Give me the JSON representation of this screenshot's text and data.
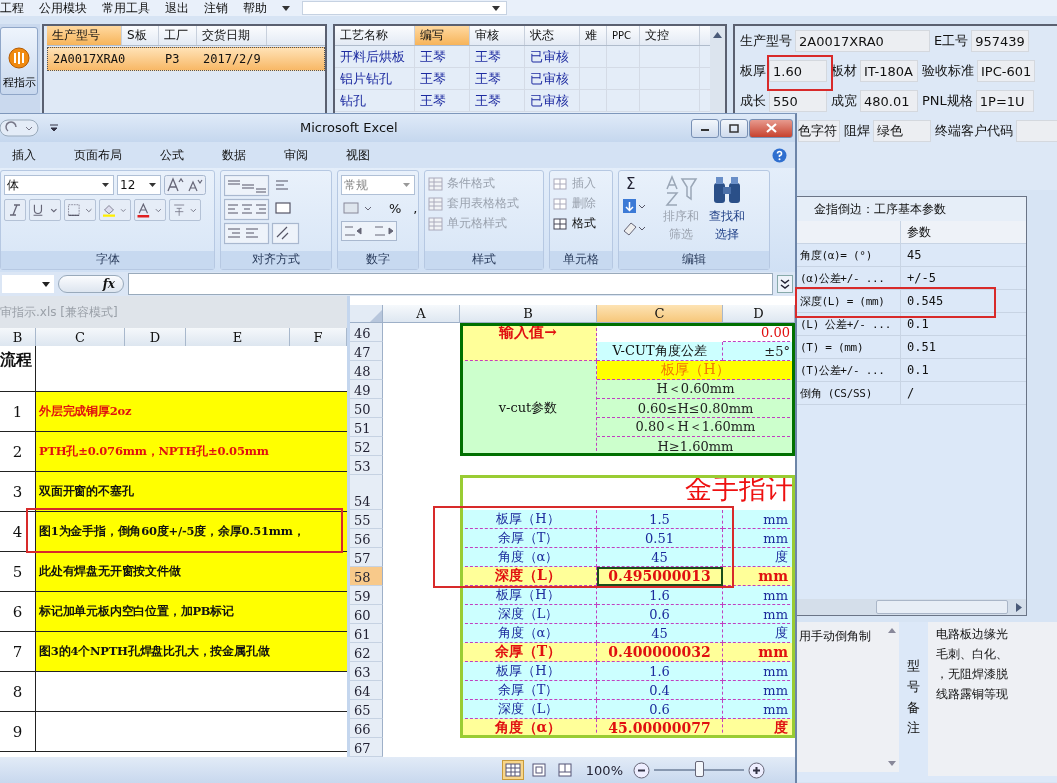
{
  "app": {
    "menu": [
      {
        "label": "工程"
      },
      {
        "label": "公用模块"
      },
      {
        "label": "常用工具"
      },
      {
        "label": "退出"
      },
      {
        "label": "注销"
      },
      {
        "label": "帮助"
      }
    ],
    "side_button": {
      "label": "程指示"
    },
    "order_table": {
      "columns": [
        {
          "label": "生产型号",
          "selected": true
        },
        {
          "label": "S板",
          "selected": false
        },
        {
          "label": "工厂",
          "selected": false
        },
        {
          "label": "交货日期",
          "selected": false
        }
      ],
      "rows": [
        {
          "model": "2A0017XRA0",
          "factory": "P3",
          "date": "2017/2/9",
          "selected": true
        }
      ]
    },
    "process_table": {
      "columns": [
        {
          "label": "工艺名称",
          "selected": false
        },
        {
          "label": "编写",
          "selected": true
        },
        {
          "label": "审核",
          "selected": false
        },
        {
          "label": "状态",
          "selected": false
        },
        {
          "label": "难",
          "selected": false
        },
        {
          "label": "PPC",
          "selected": false
        },
        {
          "label": "文控",
          "selected": false
        }
      ],
      "rows": [
        {
          "name": "开料后烘板",
          "writer": "王琴",
          "reviewer": "王琴",
          "status": "已审核"
        },
        {
          "name": "铝片钻孔",
          "writer": "王琴",
          "reviewer": "王琴",
          "status": "已审核"
        },
        {
          "name": "钻孔",
          "writer": "王琴",
          "reviewer": "王琴",
          "status": "已审核"
        }
      ]
    },
    "info_rows": [
      [
        {
          "label": "生产型号",
          "value": "2A0017XRA0"
        },
        {
          "label": "E工号",
          "value": "957439"
        }
      ],
      [
        {
          "label": "板厚",
          "value": "1.60"
        },
        {
          "label": "板材",
          "value": "IT-180A"
        },
        {
          "label": "验收标准",
          "value": "IPC-601"
        }
      ],
      [
        {
          "label": "成长",
          "value": "550"
        },
        {
          "label": "成宽",
          "value": "480.01"
        },
        {
          "label": "PNL规格",
          "value": "1P=1U"
        }
      ],
      [
        {
          "value": "色字符"
        },
        {
          "label": "阻焊",
          "value": "绿色"
        },
        {
          "label": "终端客户代码"
        }
      ]
    ],
    "param_table": {
      "title": "金指倒边：工序基本参数",
      "column": "参数",
      "rows": [
        {
          "name": "角度(α)=  (°)",
          "value": "45"
        },
        {
          "name": "(α)公差+/- ...",
          "value": "+/-5"
        },
        {
          "name": "深度(L) =  (mm)",
          "value": "0.545"
        },
        {
          "name": "(L) 公差+/- ...",
          "value": "0.1"
        },
        {
          "name": "(T) =  (mm)",
          "value": "0.51"
        },
        {
          "name": "(T)公差+/-  ...",
          "value": "0.1"
        },
        {
          "name": "倒角 (CS/SS)",
          "value": "/"
        }
      ]
    },
    "notes": {
      "left_text": "用手动倒角制",
      "label": "型号备注",
      "right_lines": [
        "电路板边缘光",
        "毛刺、白化、",
        "，无阻焊漆脱",
        "线路露铜等现"
      ]
    }
  },
  "excel": {
    "title": "Microsoft Excel",
    "tabs": [
      {
        "label": "插入"
      },
      {
        "label": "页面布局"
      },
      {
        "label": "公式"
      },
      {
        "label": "数据"
      },
      {
        "label": "审阅"
      },
      {
        "label": "视图"
      }
    ],
    "ribbon": {
      "font_name": "体",
      "font_size": "12",
      "number_format": "常规",
      "percent": "%",
      "comma": ",",
      "sum": "Σ",
      "style_buttons": [
        {
          "label": "条件格式"
        },
        {
          "label": "套用表格格式"
        },
        {
          "label": "单元格样式"
        }
      ],
      "cell_buttons": [
        {
          "label": "插入",
          "disabled": true
        },
        {
          "label": "删除",
          "disabled": true
        },
        {
          "label": "格式",
          "disabled": false
        }
      ],
      "sort_button": {
        "label": "排序和筛选",
        "disabled": true
      },
      "find_button": {
        "label": "查找和选择",
        "disabled": false
      },
      "groups": [
        {
          "label": "字体"
        },
        {
          "label": "对齐方式"
        },
        {
          "label": "数字"
        },
        {
          "label": "样式"
        },
        {
          "label": "单元格"
        },
        {
          "label": "编辑"
        }
      ]
    },
    "formula_bar": {
      "fx": "fx"
    },
    "sheet1": {
      "title": "审指示.xls  [兼容模式]",
      "columns": [
        "B",
        "C",
        "D",
        "E",
        "F"
      ],
      "header": "流程",
      "rows": [
        {
          "number": "1",
          "text": "外层完成铜厚2oz",
          "kind": "red"
        },
        {
          "number": "2",
          "text": "PTH孔±0.076mm，NPTH孔±0.05mm",
          "kind": "red"
        },
        {
          "number": "3",
          "text": "双面开窗的不塞孔",
          "kind": "black"
        },
        {
          "number": "4",
          "text": "图1为金手指，倒角60度+/-5度，余厚0.51mm，",
          "kind": "black"
        },
        {
          "number": "5",
          "text": "此处有焊盘无开窗按文件做",
          "kind": "black"
        },
        {
          "number": "6",
          "text": "标记加单元板内空白位置，加PB标记",
          "kind": "black"
        },
        {
          "number": "7",
          "text": "图3的4个NPTH孔焊盘比孔大，按金属孔做",
          "kind": "black"
        },
        {
          "number": "8",
          "kind": "empty"
        },
        {
          "number": "9",
          "kind": "empty"
        }
      ]
    },
    "sheet2": {
      "columns": [
        {
          "label": "A",
          "selected": false
        },
        {
          "label": "B",
          "selected": false
        },
        {
          "label": "C",
          "selected": true
        },
        {
          "label": "D",
          "selected": false
        }
      ],
      "row_numbers": [
        {
          "label": "46",
          "selected": false
        },
        {
          "label": "47",
          "selected": false
        },
        {
          "label": "48",
          "selected": false
        },
        {
          "label": "49",
          "selected": false
        },
        {
          "label": "50",
          "selected": false
        },
        {
          "label": "51",
          "selected": false
        },
        {
          "label": "52",
          "selected": false
        },
        {
          "label": "53",
          "selected": false
        },
        {
          "label": "54",
          "selected": false
        },
        {
          "label": "55",
          "selected": false
        },
        {
          "label": "56",
          "selected": false
        },
        {
          "label": "57",
          "selected": false
        },
        {
          "label": "58",
          "selected": true
        },
        {
          "label": "59",
          "selected": false
        },
        {
          "label": "60",
          "selected": false
        },
        {
          "label": "61",
          "selected": false
        },
        {
          "label": "62",
          "selected": false
        },
        {
          "label": "63",
          "selected": false
        },
        {
          "label": "64",
          "selected": false
        },
        {
          "label": "65",
          "selected": false
        },
        {
          "label": "66",
          "selected": false
        },
        {
          "label": "67",
          "selected": false
        }
      ],
      "input": {
        "label": "输入值→",
        "rows": [
          {
            "setting": "0.00"
          },
          {
            "name": "V-CUT角度公差",
            "setting": "±5°"
          }
        ]
      },
      "vcut": {
        "label": "v-cut参数",
        "header": "板厚（H）",
        "ranges": [
          "H＜0.60mm",
          "0.60≤H≤0.80mm",
          "0.80＜H＜1.60mm",
          "H≥1.60mm"
        ]
      },
      "gold": {
        "title": "金手指计",
        "rows": [
          {
            "label": "板厚（H）",
            "value": "1.5",
            "unit": "mm",
            "kind": "input",
            "selected": false
          },
          {
            "label": "余厚（T）",
            "value": "0.51",
            "unit": "mm",
            "kind": "input",
            "selected": false
          },
          {
            "label": "角度（α）",
            "value": "45",
            "unit": "度",
            "kind": "input",
            "selected": false
          },
          {
            "label": "深度（L）",
            "value": "0.495000013",
            "unit": "mm",
            "kind": "result",
            "selected": true
          },
          {
            "label": "板厚（H）",
            "value": "1.6",
            "unit": "mm",
            "kind": "input",
            "selected": false
          },
          {
            "label": "深度（L）",
            "value": "0.6",
            "unit": "mm",
            "kind": "input",
            "selected": false
          },
          {
            "label": "角度（α）",
            "value": "45",
            "unit": "度",
            "kind": "input",
            "selected": false
          },
          {
            "label": "余厚（T）",
            "value": "0.400000032",
            "unit": "mm",
            "kind": "result",
            "selected": false
          },
          {
            "label": "板厚（H）",
            "value": "1.6",
            "unit": "mm",
            "kind": "input",
            "selected": false
          },
          {
            "label": "余厚（T）",
            "value": "0.4",
            "unit": "mm",
            "kind": "input",
            "selected": false
          },
          {
            "label": "深度（L）",
            "value": "0.6",
            "unit": "mm",
            "kind": "input",
            "selected": false
          },
          {
            "label": "角度（α）",
            "value": "45.00000077",
            "unit": "度",
            "kind": "result",
            "selected": false
          }
        ]
      }
    },
    "status_bar": {
      "zoom": "100%",
      "zoom_slider": {
        "level": 0.5
      }
    }
  }
}
